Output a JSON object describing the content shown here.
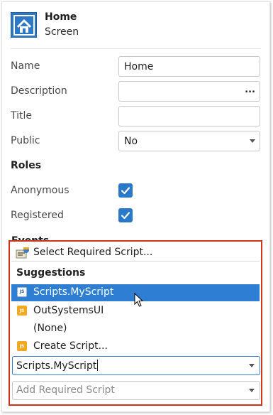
{
  "header": {
    "title": "Home",
    "subtitle": "Screen",
    "icon": "home-icon",
    "accent_color": "#2e78c6"
  },
  "properties": {
    "name_label": "Name",
    "name_value": "Home",
    "description_label": "Description",
    "description_value": "",
    "description_button": "...",
    "title_label": "Title",
    "title_value": "",
    "public_label": "Public",
    "public_value": "No"
  },
  "roles": {
    "section_label": "Roles",
    "items": [
      {
        "label": "Anonymous",
        "checked": true
      },
      {
        "label": "Registered",
        "checked": true
      }
    ]
  },
  "events": {
    "section_label": "Events"
  },
  "dropdown": {
    "highlight_color": "#d0321b",
    "select_label": "Select Required Script...",
    "suggestions_heading": "Suggestions",
    "items": [
      {
        "label": "Scripts.MyScript",
        "icon": "js-file-icon",
        "selected": true
      },
      {
        "label": "OutSystemsUI",
        "icon": "js-module-icon",
        "selected": false
      },
      {
        "label": "(None)",
        "icon": "",
        "selected": false
      },
      {
        "label": "Create Script...",
        "icon": "js-module-icon",
        "selected": false
      }
    ],
    "combo_value": "Scripts.MyScript",
    "add_placeholder": "Add Required Script"
  }
}
